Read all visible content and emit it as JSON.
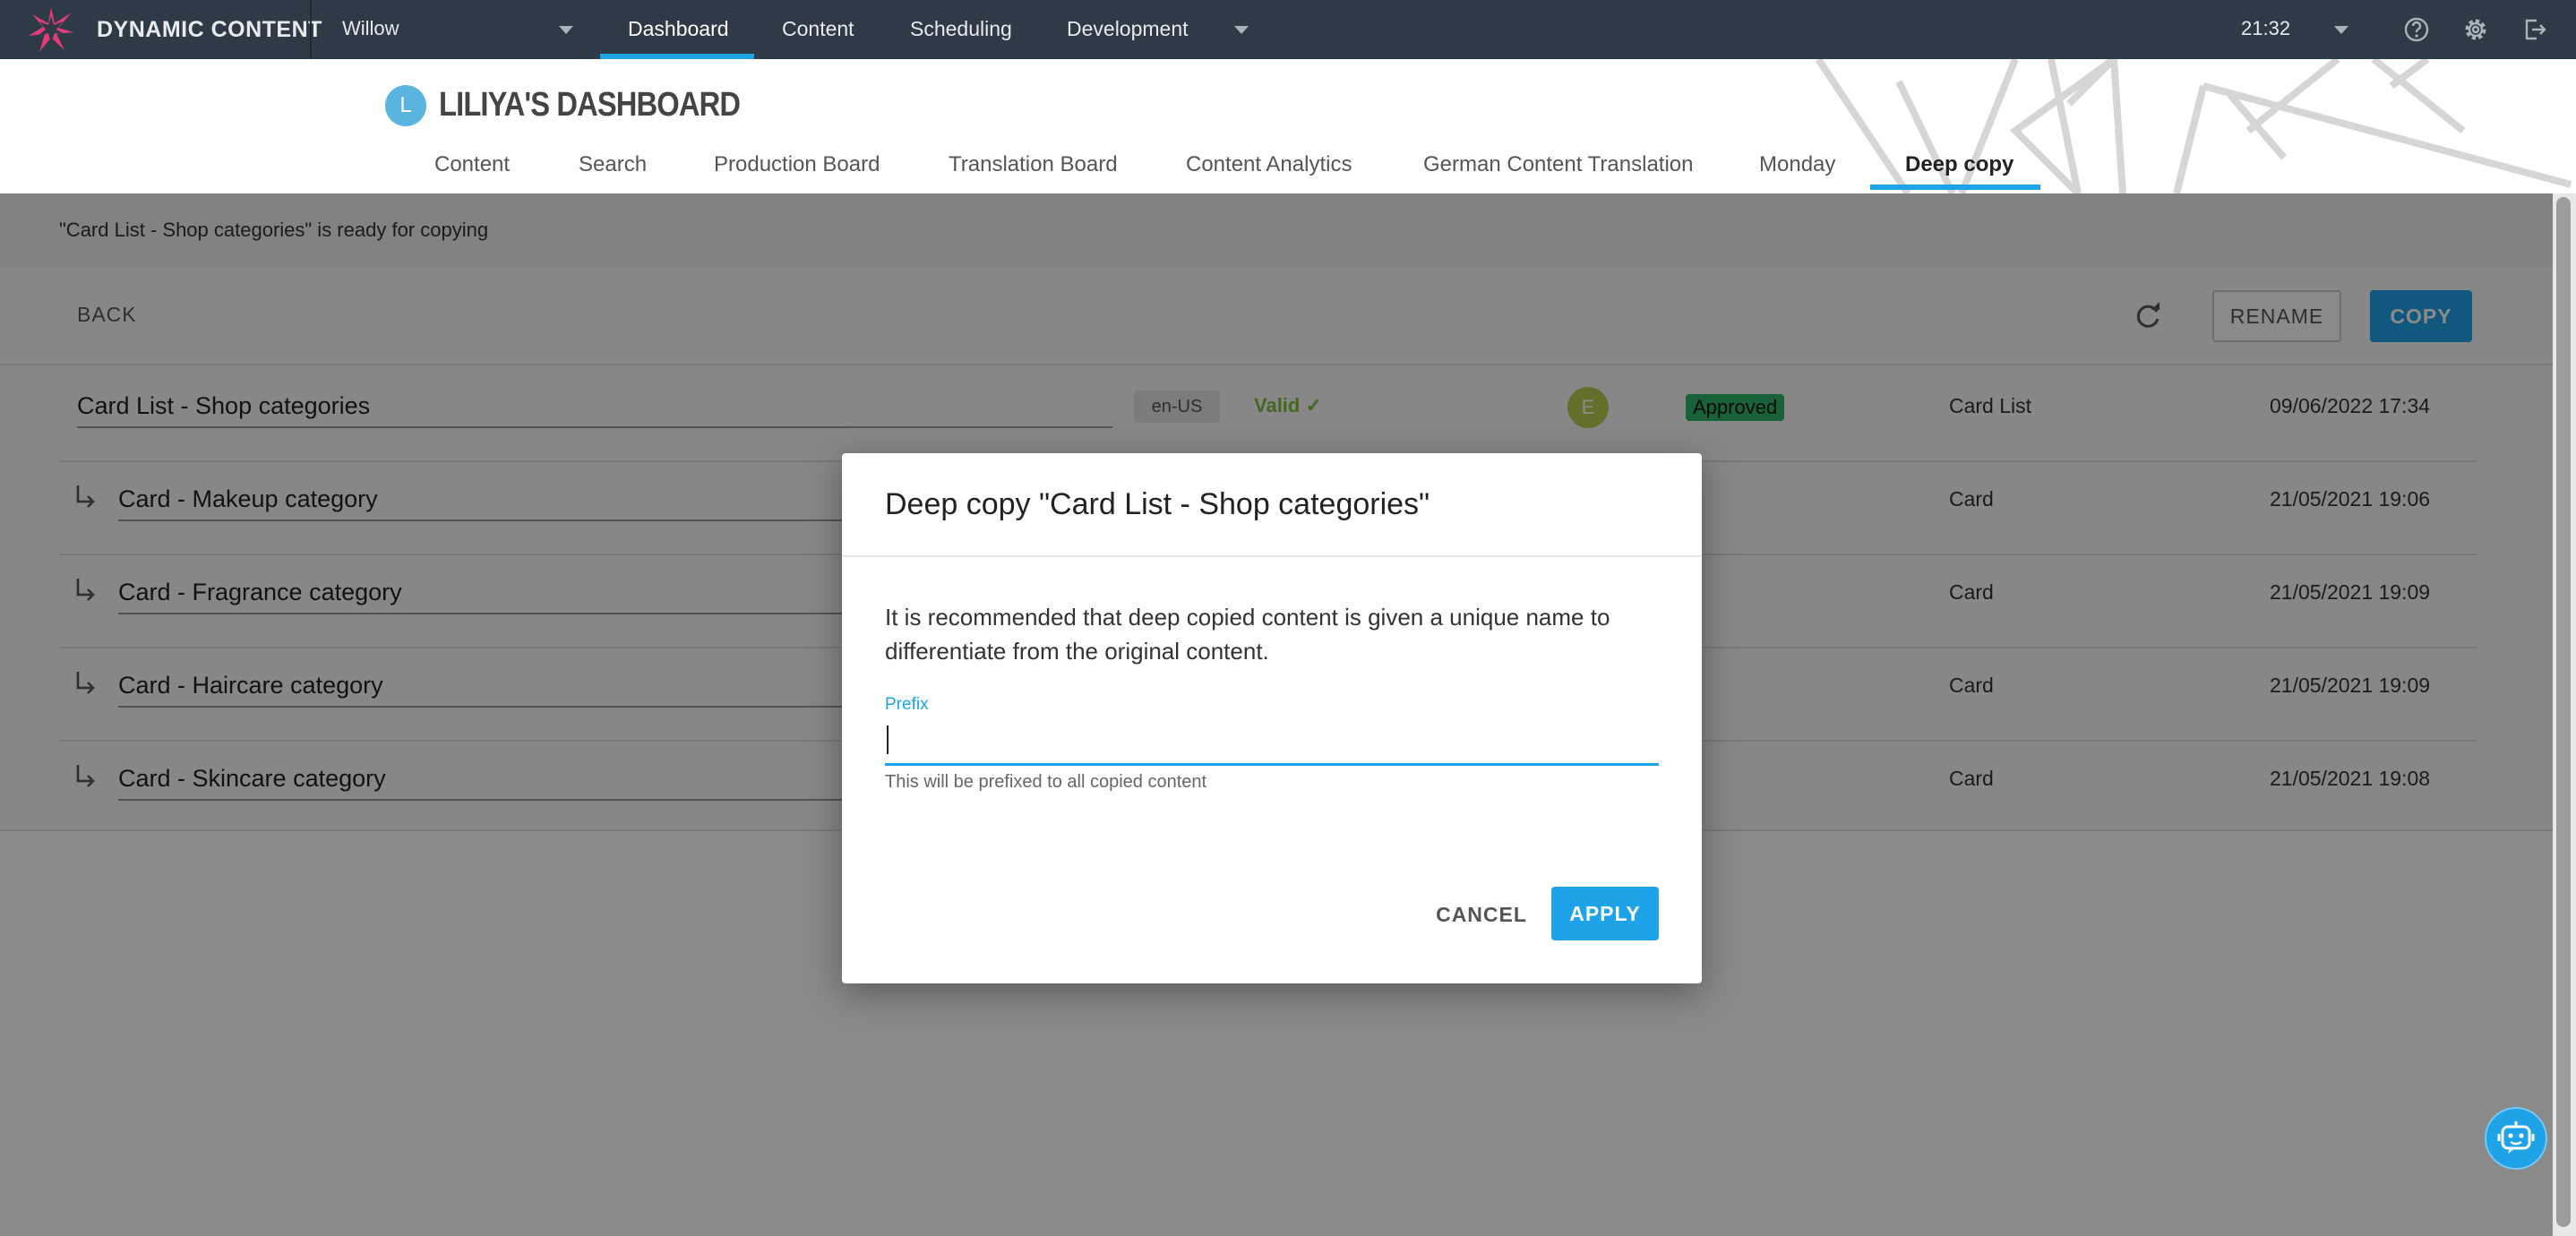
{
  "topbar": {
    "brand": "DYNAMIC CONTENT",
    "hub": "Willow",
    "nav": [
      {
        "label": "Dashboard",
        "active": true
      },
      {
        "label": "Content"
      },
      {
        "label": "Scheduling"
      },
      {
        "label": "Development"
      }
    ],
    "time": "21:32",
    "accent": "#1ea3e8",
    "icons": [
      "help-icon",
      "settings-icon",
      "logout-icon"
    ]
  },
  "dashboard": {
    "avatar_initial": "L",
    "title": "LILIYA'S DASHBOARD",
    "tabs": [
      {
        "label": "Content"
      },
      {
        "label": "Search"
      },
      {
        "label": "Production Board"
      },
      {
        "label": "Translation Board"
      },
      {
        "label": "Content Analytics"
      },
      {
        "label": "German Content Translation"
      },
      {
        "label": "Monday"
      },
      {
        "label": "Deep copy",
        "active": true
      }
    ]
  },
  "deep_copy": {
    "notice": "\"Card List - Shop categories\" is ready for copying",
    "back_label": "BACK",
    "rename_label": "RENAME",
    "copy_label": "COPY",
    "rows": [
      {
        "name": "Card List - Shop categories",
        "locale": "en-US",
        "validity": "Valid",
        "assignee": "E",
        "status": "Approved",
        "type": "Card List",
        "date": "09/06/2022 17:34"
      },
      {
        "name": "Card - Makeup category",
        "type": "Card",
        "date": "21/05/2021 19:06"
      },
      {
        "name": "Card - Fragrance category",
        "type": "Card",
        "date": "21/05/2021 19:09"
      },
      {
        "name": "Card - Haircare category",
        "type": "Card",
        "date": "21/05/2021 19:09"
      },
      {
        "name": "Card - Skincare category",
        "type": "Card",
        "date": "21/05/2021 19:08"
      }
    ]
  },
  "modal": {
    "title": "Deep copy \"Card List - Shop categories\"",
    "message": "It is recommended that deep copied content is given a unique name to differentiate from the original content.",
    "prefix_label": "Prefix",
    "prefix_value": "",
    "prefix_hint": "This will be prefixed to all copied content",
    "cancel_label": "CANCEL",
    "apply_label": "APPLY"
  }
}
